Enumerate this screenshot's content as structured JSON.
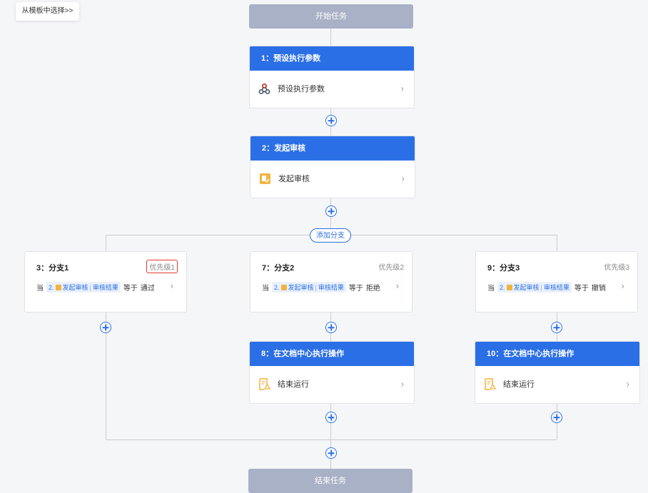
{
  "template_button": "从模板中选择>>",
  "start_node": "开始任务",
  "end_node": "结束任务",
  "add_branch": "添加分支",
  "step1": {
    "header": "1：预设执行参数",
    "body": "预设执行参数",
    "icon": "webhook-icon"
  },
  "step2": {
    "header": "2：发起审核",
    "body": "发起审核",
    "icon": "approval-icon"
  },
  "branches": [
    {
      "title": "3：分支1",
      "priority": "优先级1",
      "cond_prefix": "当",
      "cond_ref_num": "2.",
      "cond_ref_a": "发起审核",
      "cond_ref_sep": "|",
      "cond_ref_b": "审核结果",
      "cond_op": "等于",
      "cond_value": "通过"
    },
    {
      "title": "7：分支2",
      "priority": "优先级2",
      "cond_prefix": "当",
      "cond_ref_num": "2.",
      "cond_ref_a": "发起审核",
      "cond_ref_sep": "|",
      "cond_ref_b": "审核结果",
      "cond_op": "等于",
      "cond_value": "拒绝"
    },
    {
      "title": "9：分支3",
      "priority": "优先级3",
      "cond_prefix": "当",
      "cond_ref_num": "2.",
      "cond_ref_a": "发起审核",
      "cond_ref_sep": "|",
      "cond_ref_b": "审核结果",
      "cond_op": "等于",
      "cond_value": "撤销"
    }
  ],
  "step8": {
    "header": "8：在文档中心执行操作",
    "body": "结束运行",
    "icon": "document-action-icon"
  },
  "step10": {
    "header": "10：在文档中心执行操作",
    "body": "结束运行",
    "icon": "document-action-icon"
  },
  "colors": {
    "primary": "#2b6fe6",
    "node_gray": "#a9b1c7",
    "highlight": "#e53935",
    "icon_orange": "#f3b33d"
  }
}
